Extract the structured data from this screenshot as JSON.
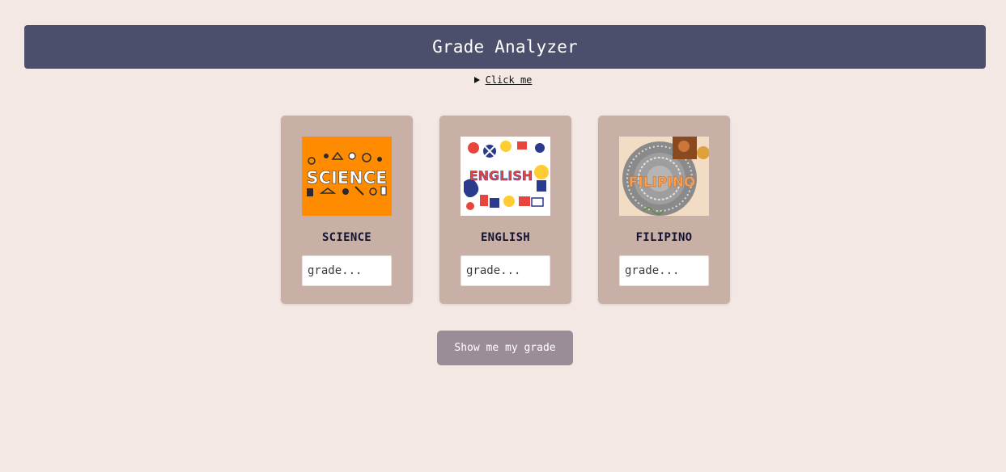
{
  "header": {
    "title": "Grade Analyzer"
  },
  "details": {
    "summary": "Click me"
  },
  "subjects": [
    {
      "name": "SCIENCE",
      "image_text": "SCIENCE",
      "placeholder": "grade..."
    },
    {
      "name": "ENGLISH",
      "image_text": "ENGLISH",
      "placeholder": "grade..."
    },
    {
      "name": "FILIPINO",
      "image_text": "FILIPINO",
      "placeholder": "grade..."
    }
  ],
  "actions": {
    "show_grade_label": "Show me my grade"
  },
  "colors": {
    "background": "#f3e8e4",
    "header": "#4b4f6b",
    "card": "#c9b0a7",
    "button": "#9b8d97"
  }
}
